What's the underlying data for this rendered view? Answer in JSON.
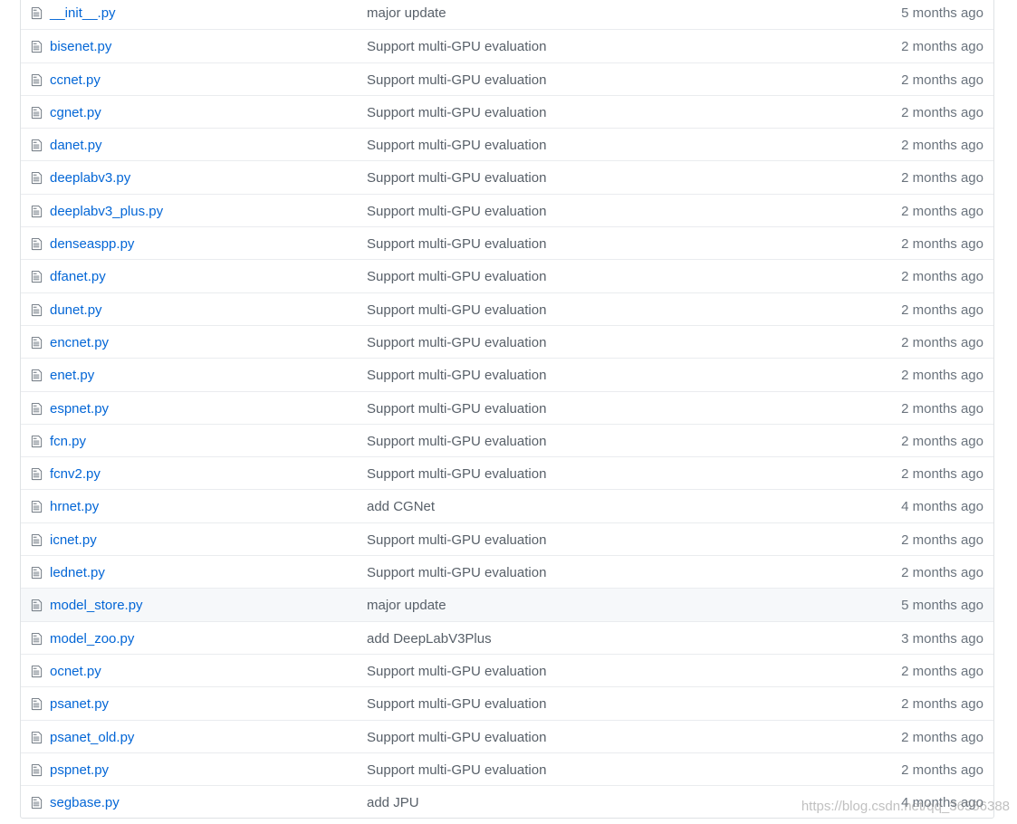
{
  "icons": {
    "file": "file-text-icon"
  },
  "colors": {
    "link": "#0366d6",
    "message": "#586069",
    "age": "#6a737d",
    "hover_row": "#f6f8fa",
    "border": "#dfe2e5"
  },
  "files": [
    {
      "name": "__init__.py",
      "message": "major update",
      "age": "5 months ago"
    },
    {
      "name": "bisenet.py",
      "message": "Support multi-GPU evaluation",
      "age": "2 months ago"
    },
    {
      "name": "ccnet.py",
      "message": "Support multi-GPU evaluation",
      "age": "2 months ago"
    },
    {
      "name": "cgnet.py",
      "message": "Support multi-GPU evaluation",
      "age": "2 months ago"
    },
    {
      "name": "danet.py",
      "message": "Support multi-GPU evaluation",
      "age": "2 months ago"
    },
    {
      "name": "deeplabv3.py",
      "message": "Support multi-GPU evaluation",
      "age": "2 months ago"
    },
    {
      "name": "deeplabv3_plus.py",
      "message": "Support multi-GPU evaluation",
      "age": "2 months ago"
    },
    {
      "name": "denseaspp.py",
      "message": "Support multi-GPU evaluation",
      "age": "2 months ago"
    },
    {
      "name": "dfanet.py",
      "message": "Support multi-GPU evaluation",
      "age": "2 months ago"
    },
    {
      "name": "dunet.py",
      "message": "Support multi-GPU evaluation",
      "age": "2 months ago"
    },
    {
      "name": "encnet.py",
      "message": "Support multi-GPU evaluation",
      "age": "2 months ago"
    },
    {
      "name": "enet.py",
      "message": "Support multi-GPU evaluation",
      "age": "2 months ago"
    },
    {
      "name": "espnet.py",
      "message": "Support multi-GPU evaluation",
      "age": "2 months ago"
    },
    {
      "name": "fcn.py",
      "message": "Support multi-GPU evaluation",
      "age": "2 months ago"
    },
    {
      "name": "fcnv2.py",
      "message": "Support multi-GPU evaluation",
      "age": "2 months ago"
    },
    {
      "name": "hrnet.py",
      "message": "add CGNet",
      "age": "4 months ago"
    },
    {
      "name": "icnet.py",
      "message": "Support multi-GPU evaluation",
      "age": "2 months ago"
    },
    {
      "name": "lednet.py",
      "message": "Support multi-GPU evaluation",
      "age": "2 months ago"
    },
    {
      "name": "model_store.py",
      "message": "major update",
      "age": "5 months ago",
      "hovered": true
    },
    {
      "name": "model_zoo.py",
      "message": "add DeepLabV3Plus",
      "age": "3 months ago"
    },
    {
      "name": "ocnet.py",
      "message": "Support multi-GPU evaluation",
      "age": "2 months ago"
    },
    {
      "name": "psanet.py",
      "message": "Support multi-GPU evaluation",
      "age": "2 months ago"
    },
    {
      "name": "psanet_old.py",
      "message": "Support multi-GPU evaluation",
      "age": "2 months ago"
    },
    {
      "name": "pspnet.py",
      "message": "Support multi-GPU evaluation",
      "age": "2 months ago"
    },
    {
      "name": "segbase.py",
      "message": "add JPU",
      "age": "4 months ago"
    }
  ],
  "watermark": "https://blog.csdn.net/qq_36556388"
}
